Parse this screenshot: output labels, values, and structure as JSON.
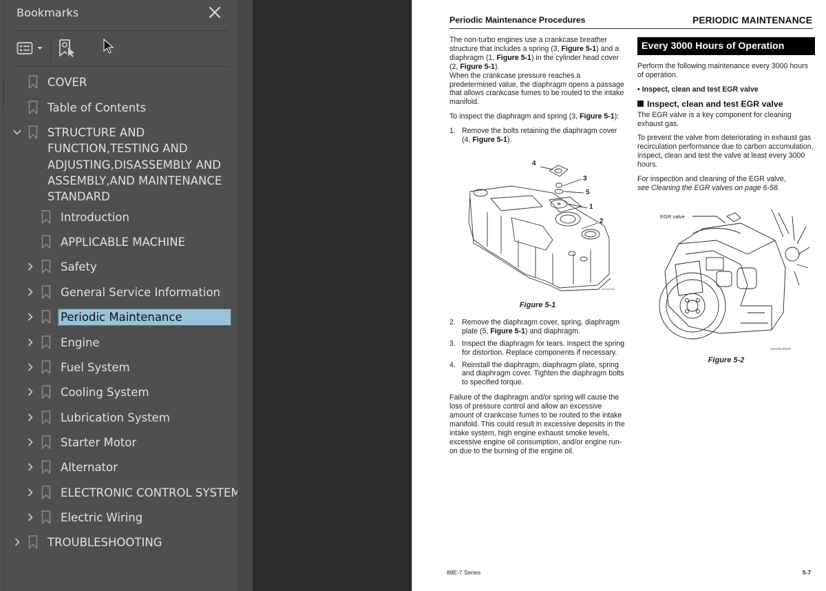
{
  "sidebar": {
    "title": "Bookmarks",
    "close_icon": "close-icon",
    "toolbar": {
      "options_icon": "list-options-icon",
      "find_icon": "find-current-bookmark-icon"
    },
    "bookmarks": [
      {
        "label": "COVER",
        "level": 0,
        "expander": "none"
      },
      {
        "label": "Table of Contents",
        "level": 0,
        "expander": "none"
      },
      {
        "label": "STRUCTURE AND FUNCTION,TESTING AND ADJUSTING,DISASSEMBLY AND ASSEMBLY,AND MAINTENANCE STANDARD",
        "level": 0,
        "expander": "expanded"
      },
      {
        "label": "Introduction",
        "level": 1,
        "expander": "none"
      },
      {
        "label": "APPLICABLE MACHINE",
        "level": 1,
        "expander": "none"
      },
      {
        "label": "Safety",
        "level": 1,
        "expander": "collapsed"
      },
      {
        "label": "General Service Information",
        "level": 1,
        "expander": "collapsed"
      },
      {
        "label": "Periodic Maintenance",
        "level": 1,
        "expander": "collapsed",
        "selected": true
      },
      {
        "label": "Engine",
        "level": 1,
        "expander": "collapsed"
      },
      {
        "label": "Fuel System",
        "level": 1,
        "expander": "collapsed"
      },
      {
        "label": "Cooling System",
        "level": 1,
        "expander": "collapsed"
      },
      {
        "label": "Lubrication System",
        "level": 1,
        "expander": "collapsed"
      },
      {
        "label": "Starter Motor",
        "level": 1,
        "expander": "collapsed"
      },
      {
        "label": "Alternator",
        "level": 1,
        "expander": "collapsed"
      },
      {
        "label": "ELECTRONIC CONTROL SYSTEM",
        "level": 1,
        "expander": "collapsed"
      },
      {
        "label": "Electric Wiring",
        "level": 1,
        "expander": "collapsed"
      },
      {
        "label": "TROUBLESHOOTING",
        "level": 0,
        "expander": "collapsed"
      }
    ],
    "selected_color": "#99c2db"
  },
  "page": {
    "header_left": "Periodic Maintenance Procedures",
    "header_right": "PERIODIC MAINTENANCE",
    "left": {
      "intro_p1_a": "The non-turbo engines use a crankcase breather structure that includes a spring (3, ",
      "fig_ref": "Figure 5-1",
      "intro_p1_b": ") and a diaphragm (1, ",
      "intro_p1_c": ") in the cylinder head cover (2, ",
      "intro_p1_d": ").",
      "intro_p2": "When the crankcase pressure reaches a predetermined value, the diaphragm opens a passage that allows crankcase fumes to be routed to the intake manifold.",
      "inspect_a": "To inspect the diaphragm and spring (3, ",
      "inspect_b": "):",
      "step1_num": "1.",
      "step1_a": "Remove the bolts retaining the diaphragm cover (4, ",
      "step1_b": ").",
      "figure1_caption": "Figure 5-1",
      "figure1_callouts": [
        "4",
        "3",
        "5",
        "1",
        "2"
      ],
      "figure1_code": "8000215S",
      "step2_num": "2.",
      "step2_a": "Remove the diaphragm cover, spring, diaphragm plate (5, ",
      "step2_b": ") and diaphragm.",
      "step3_num": "3.",
      "step3": "Inspect the diaphragm for tears. Inspect the spring for distortion. Replace components if necessary.",
      "step4_num": "4.",
      "step4": "Reinstall the diaphragm, diaphragm plate, spring and diaphragm cover. Tighten the diaphragm bolts to specified torque.",
      "failure": "Failure of the diaphragm and/or spring will cause the loss of pressure control and allow an excessive amount of crankcase fumes to be routed to the intake manifold. This could result in excessive deposits in the intake system, high engine exhaust smoke levels, excessive engine oil consumption, and/or engine run-on due to the burning of the engine oil."
    },
    "right": {
      "banner": "Every 3000 Hours of Operation",
      "perform": "Perform the following maintenance every 3000 hours of operation.",
      "bullet": "• Inspect, clean and test EGR valve",
      "section_head": "Inspect, clean and test EGR valve",
      "egr_p1": "The EGR valve is a key component for cleaning exhaust gas.",
      "egr_p2": "To prevent the valve from deteriorating in exhaust gas recirculation performance due to carbon accumulation, inspect, clean and test the valve at least every 3000 hours.",
      "egr_p3_a": "For inspection and cleaning of the EGR valve,",
      "egr_p3_b": "see  Cleaning the EGR valves on page 6-58.",
      "figure2_label": "EGR valve",
      "figure2_code": "0A6346-00E01",
      "figure2_caption": "Figure 5-2"
    },
    "footer_left": "88E-7 Series",
    "footer_right": "5-7"
  }
}
